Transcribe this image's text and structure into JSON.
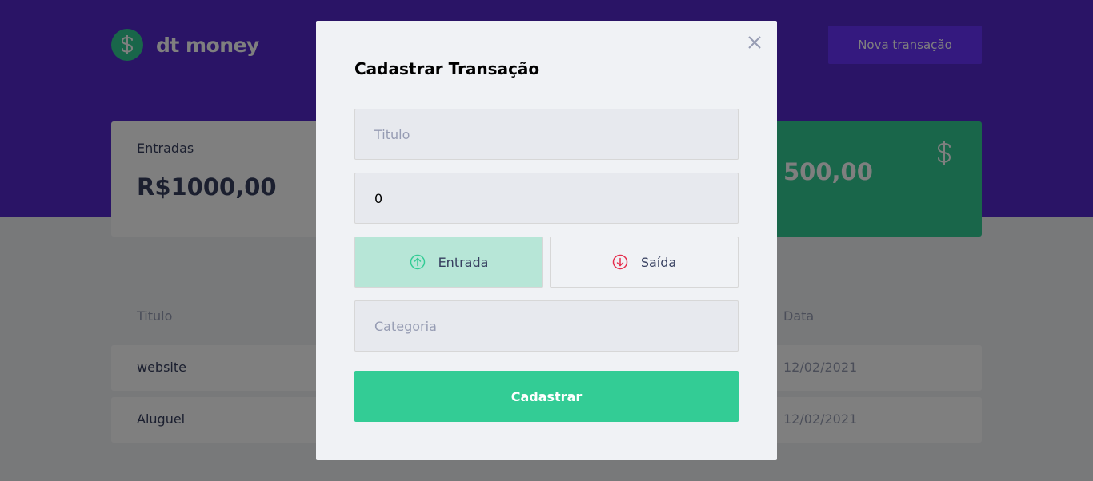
{
  "header": {
    "app_name": "dt money",
    "new_transaction_label": "Nova transação",
    "brand_color": "#5429cc",
    "accent_green": "#33cc95"
  },
  "summary": {
    "income_label": "Entradas",
    "income_value": "R$1000,00",
    "total_value_partial": "500,00"
  },
  "table": {
    "headers": {
      "title": "Titulo",
      "date": "Data"
    },
    "rows": [
      {
        "title": "website",
        "date": "12/02/2021"
      },
      {
        "title": "Aluguel",
        "date": "12/02/2021"
      }
    ]
  },
  "modal": {
    "title": "Cadastrar Transação",
    "title_placeholder": "Titulo",
    "amount_value": "0",
    "type_income_label": "Entrada",
    "type_outcome_label": "Saída",
    "selected_type": "Entrada",
    "category_placeholder": "Categoria",
    "submit_label": "Cadastrar",
    "icons": {
      "close": "close-icon",
      "income": "arrow-up-circle-icon",
      "outcome": "arrow-down-circle-icon"
    }
  }
}
